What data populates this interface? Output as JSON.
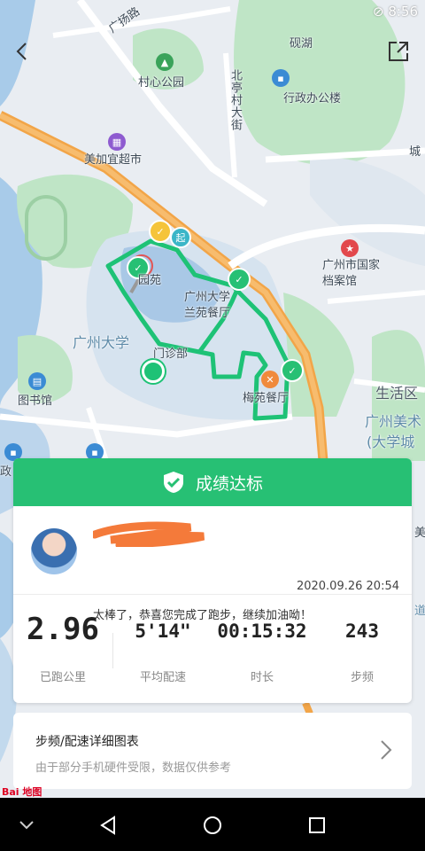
{
  "status_bar": {
    "time": "8:56"
  },
  "map": {
    "labels": {
      "guangyang_road": "广扬路",
      "yanhu": "砚湖",
      "cunxin_park": "村心公园",
      "beiting_street": "北亭村大街",
      "admin_building": "行政办公楼",
      "city": "城",
      "meijiayi": "美加宜超市",
      "archive": "广州市国家档案馆",
      "lanyuan": "园苑",
      "canteen": "广州大学兰苑餐厅",
      "gzu": "广州大学",
      "clinic": "门诊部",
      "meiyuan": "梅苑餐厅",
      "library": "图书馆",
      "life_area": "生活区",
      "art": "广州美术",
      "art2": "(大学城",
      "zheng": "政",
      "start_marker": "起",
      "right_edge1": "美",
      "right_edge2": "道",
      "baidu": "Bai 地图"
    },
    "route_color": "#1ec276"
  },
  "card": {
    "banner": "成绩达标",
    "datetime": "2020.09.26 20:54",
    "message": "太棒了，恭喜您完成了跑步，继续加油呦！",
    "stats": [
      {
        "value": "2.96",
        "label": "已跑公里"
      },
      {
        "value": "5'14\"",
        "label": "平均配速"
      },
      {
        "value": "00:15:32",
        "label": "时长"
      },
      {
        "value": "243",
        "label": "步频"
      }
    ]
  },
  "detail": {
    "title": "步频/配速详细图表",
    "subtitle": "由于部分手机硬件受限，数据仅供参考"
  },
  "colors": {
    "accent": "#27c074",
    "route": "#1ec276"
  }
}
